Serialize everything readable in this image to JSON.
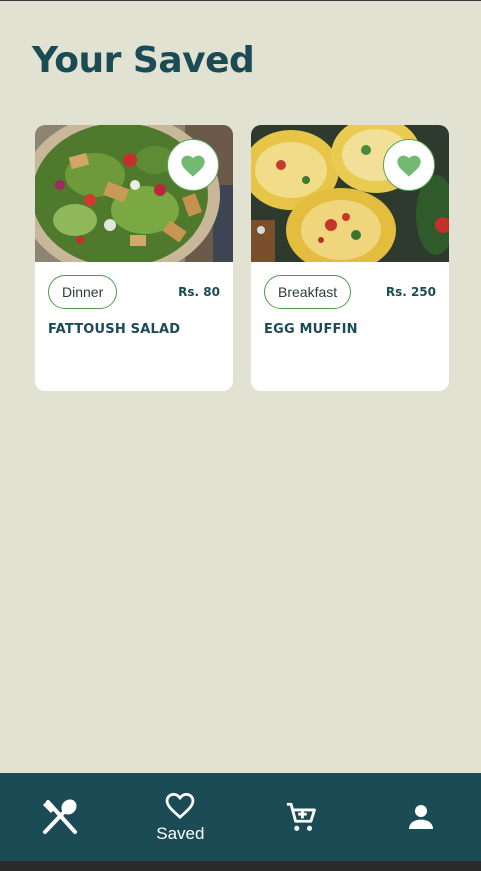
{
  "page": {
    "title": "Your Saved"
  },
  "cards": [
    {
      "tag": "Dinner",
      "price": "Rs. 80",
      "name": "FATTOUSH SALAD",
      "image": "fattoush-salad-photo",
      "favorite_icon": "heart-filled-icon"
    },
    {
      "tag": "Breakfast",
      "price": "Rs. 250",
      "name": "EGG MUFFIN",
      "image": "egg-muffin-photo",
      "favorite_icon": "heart-filled-icon"
    }
  ],
  "nav": {
    "items": [
      {
        "icon": "utensils-icon",
        "label": ""
      },
      {
        "icon": "heart-outline-icon",
        "label": "Saved"
      },
      {
        "icon": "cart-icon",
        "label": ""
      },
      {
        "icon": "person-icon",
        "label": ""
      }
    ]
  },
  "colors": {
    "background": "#e1e2d2",
    "primary": "#1b4b55",
    "accent": "#5aa65a",
    "card": "#ffffff"
  }
}
